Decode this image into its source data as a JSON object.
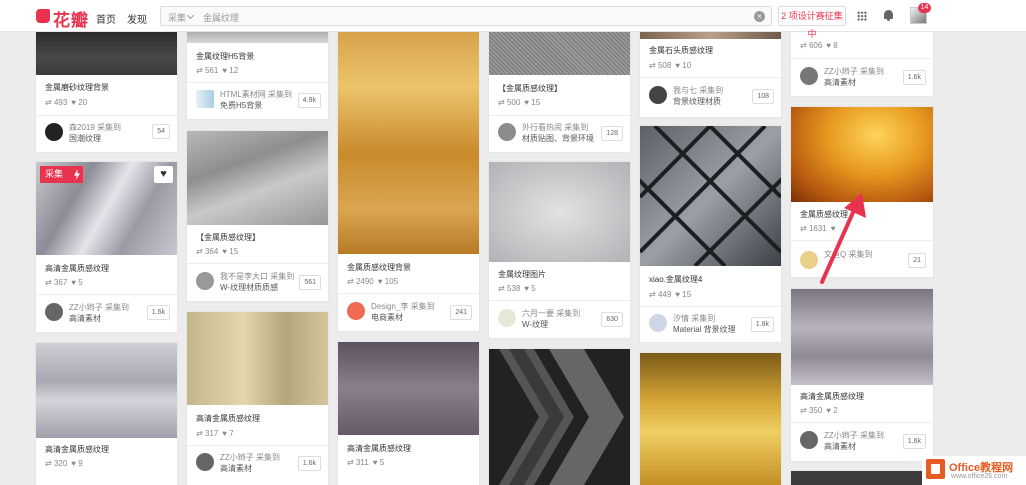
{
  "header": {
    "logo_text": "花瓣",
    "nav": [
      "首页",
      "发现"
    ],
    "search": {
      "scope": "采集",
      "value": "金属纹理",
      "clear_icon": "clear-icon"
    },
    "contest": "2 项设计赛征集中",
    "notification_count": "14"
  },
  "overlay": {
    "collect": "采集"
  },
  "columns": [
    [
      {
        "title": "金属磨砂纹理背景",
        "repins": "493",
        "likes": "20",
        "user_line1": "森2019 采集到",
        "user_line2": "国潮纹理",
        "count": "54"
      },
      {
        "title": "高清金属质感纹理",
        "repins": "367",
        "likes": "5",
        "user_line1": "ZZ小辫子 采集到",
        "user_line2": "高清素材",
        "count": "1.6k"
      },
      {
        "title": "高清金属质感纹理",
        "repins": "320",
        "likes": "9"
      }
    ],
    [
      {
        "title": "金属纹理H5背景",
        "repins": "561",
        "likes": "12",
        "user_line1": "HTML素材网 采集到",
        "user_line2": "免费H5背景",
        "count": "4.9k"
      },
      {
        "title": "【金属质感纹理】",
        "repins": "364",
        "likes": "15",
        "user_line1": "我不是李大口 采集到",
        "user_line2": "W-纹理材质质感",
        "count": "561"
      },
      {
        "title": "高清金属质感纹理",
        "repins": "317",
        "likes": "7",
        "user_line1": "ZZ小辫子 采集到",
        "user_line2": "高清素材",
        "count": "1.6k"
      }
    ],
    [
      {
        "title": "金属质感纹理背景",
        "repins": "2490",
        "likes": "105",
        "user_line1": "Design_李 采集到",
        "user_line2": "电商素材",
        "count": "241"
      },
      {
        "title": "高清金属质感纹理",
        "repins": "311",
        "likes": "5"
      }
    ],
    [
      {
        "title": "【金属质感纹理】",
        "repins": "500",
        "likes": "15",
        "user_line1": "外行看热闹 采集到",
        "user_line2": "材质贴图、背景环境",
        "count": "128"
      },
      {
        "title": "金属纹理图片",
        "repins": "538",
        "likes": "5",
        "user_line1": "六月一要 采集到",
        "user_line2": "W-纹理",
        "count": "630"
      }
    ],
    [
      {
        "title": "金属石头质感纹理",
        "repins": "508",
        "likes": "10",
        "user_line1": "我与七 采集到",
        "user_line2": "背景纹理材质",
        "count": "108"
      },
      {
        "title": "xiao.金属纹理4",
        "repins": "449",
        "likes": "15",
        "user_line1": "汐情 采集到",
        "user_line2": "Material 背景纹理",
        "count": "1.8k"
      }
    ],
    [
      {
        "title": "",
        "repins": "606",
        "likes": "8",
        "user_line1": "ZZ小辫子 采集到",
        "user_line2": "高清素材",
        "count": "1.6k"
      },
      {
        "title": "金属质感纹理",
        "repins": "1631",
        "likes": "",
        "user_line1": "文鱼Q 采集到",
        "user_line2": "",
        "count": "21"
      },
      {
        "title": "高清金属质感纹理",
        "repins": "350",
        "likes": "2",
        "user_line1": "ZZ小辫子 采集到",
        "user_line2": "高清素材",
        "count": "1.6k"
      }
    ]
  ],
  "watermark": {
    "line1": "Office教程网",
    "line2": "www.office26.com"
  },
  "colors": {
    "brand": "#e8334f",
    "annotation_arrow": "#e8334f"
  }
}
